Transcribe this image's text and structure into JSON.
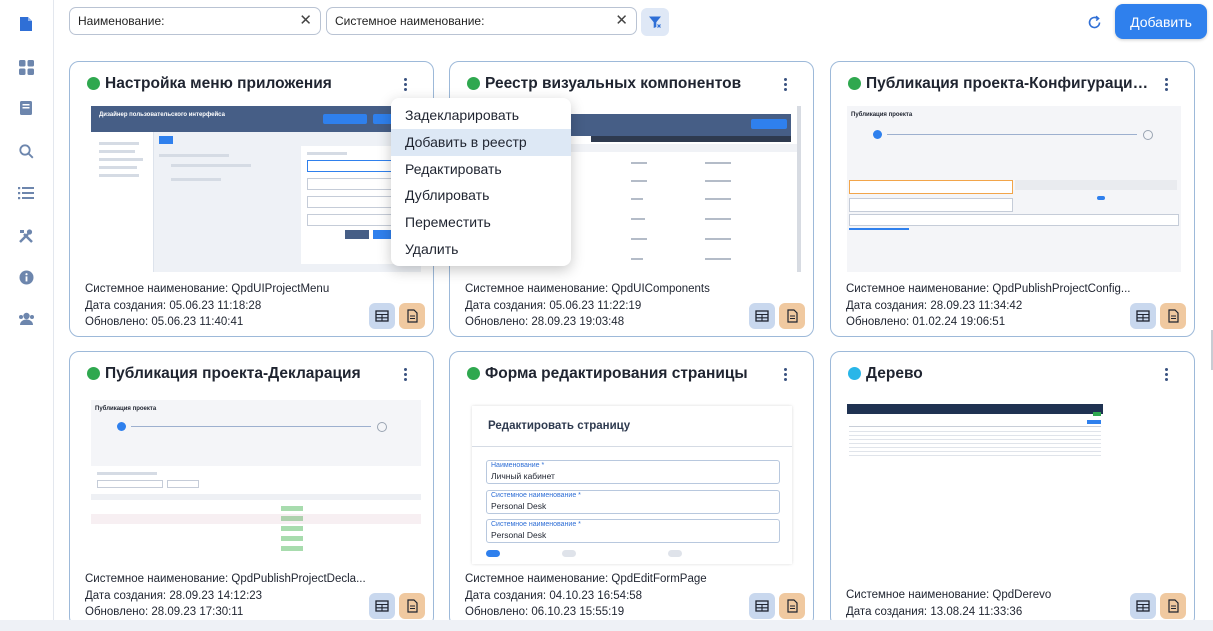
{
  "sidebar": {
    "icons": [
      "document-icon",
      "grid-icon",
      "book-icon",
      "search-icon",
      "list-icon",
      "tools-icon",
      "info-icon",
      "users-icon"
    ]
  },
  "filters": {
    "name": {
      "value": "Наименование:"
    },
    "system_name": {
      "value": "Системное наименование:"
    }
  },
  "toolbar": {
    "add_label": "Добавить"
  },
  "cards": [
    {
      "title": "Настройка меню приложения",
      "status_color": "#2fa84f",
      "system_label": "Системное наименование:",
      "system_value": "QpdUIProjectMenu",
      "created_label": "Дата создания:",
      "created_value": "05.06.23 11:18:28",
      "updated_label": "Обновлено:",
      "updated_value": "05.06.23 11:40:41",
      "thumb": {
        "header": "Дизайнер пользовательского интерфейса"
      }
    },
    {
      "title": "Реестр визуальных компонентов",
      "status_color": "#2fa84f",
      "system_label": "Системное наименование:",
      "system_value": "QpdUIComponents",
      "created_label": "Дата создания:",
      "created_value": "05.06.23 11:22:19",
      "updated_label": "Обновлено:",
      "updated_value": "28.09.23 19:03:48"
    },
    {
      "title": "Публикация проекта-Конфигурация ...",
      "status_color": "#2fa84f",
      "system_label": "Системное наименование:",
      "system_value": "QpdPublishProjectConfig...",
      "created_label": "Дата создания:",
      "created_value": "28.09.23 11:34:42",
      "updated_label": "Обновлено:",
      "updated_value": "01.02.24 19:06:51",
      "thumb": {
        "header": "Публикация проекта"
      }
    },
    {
      "title": "Публикация проекта-Декларация",
      "status_color": "#2fa84f",
      "system_label": "Системное наименование:",
      "system_value": "QpdPublishProjectDecla...",
      "created_label": "Дата создания:",
      "created_value": "28.09.23 14:12:23",
      "updated_label": "Обновлено:",
      "updated_value": "28.09.23 17:30:11",
      "thumb": {
        "header": "Публикация проекта"
      }
    },
    {
      "title": "Форма редактирования страницы",
      "status_color": "#2fa84f",
      "system_label": "Системное наименование:",
      "system_value": "QpdEditFormPage",
      "created_label": "Дата создания:",
      "created_value": "04.10.23 16:54:58",
      "updated_label": "Обновлено:",
      "updated_value": "06.10.23 15:55:19",
      "thumb": {
        "header": "Редактировать страницу",
        "f1_label": "Наименование *",
        "f1_value": "Личный кабинет",
        "f2_label": "Системное наименование *",
        "f2_value": "Personal Desk",
        "f3_label": "Системное наименование *",
        "f3_value": "Personal Desk"
      }
    },
    {
      "title": "Дерево",
      "status_color": "#29b6e8",
      "system_label": "Системное наименование:",
      "system_value": "QpdDerevo",
      "created_label": "Дата создания:",
      "created_value": "13.08.24 11:33:36"
    }
  ],
  "context_menu": {
    "items": [
      "Задекларировать",
      "Добавить в реестр",
      "Редактировать",
      "Дублировать",
      "Переместить",
      "Удалить"
    ],
    "active_index": 1
  }
}
